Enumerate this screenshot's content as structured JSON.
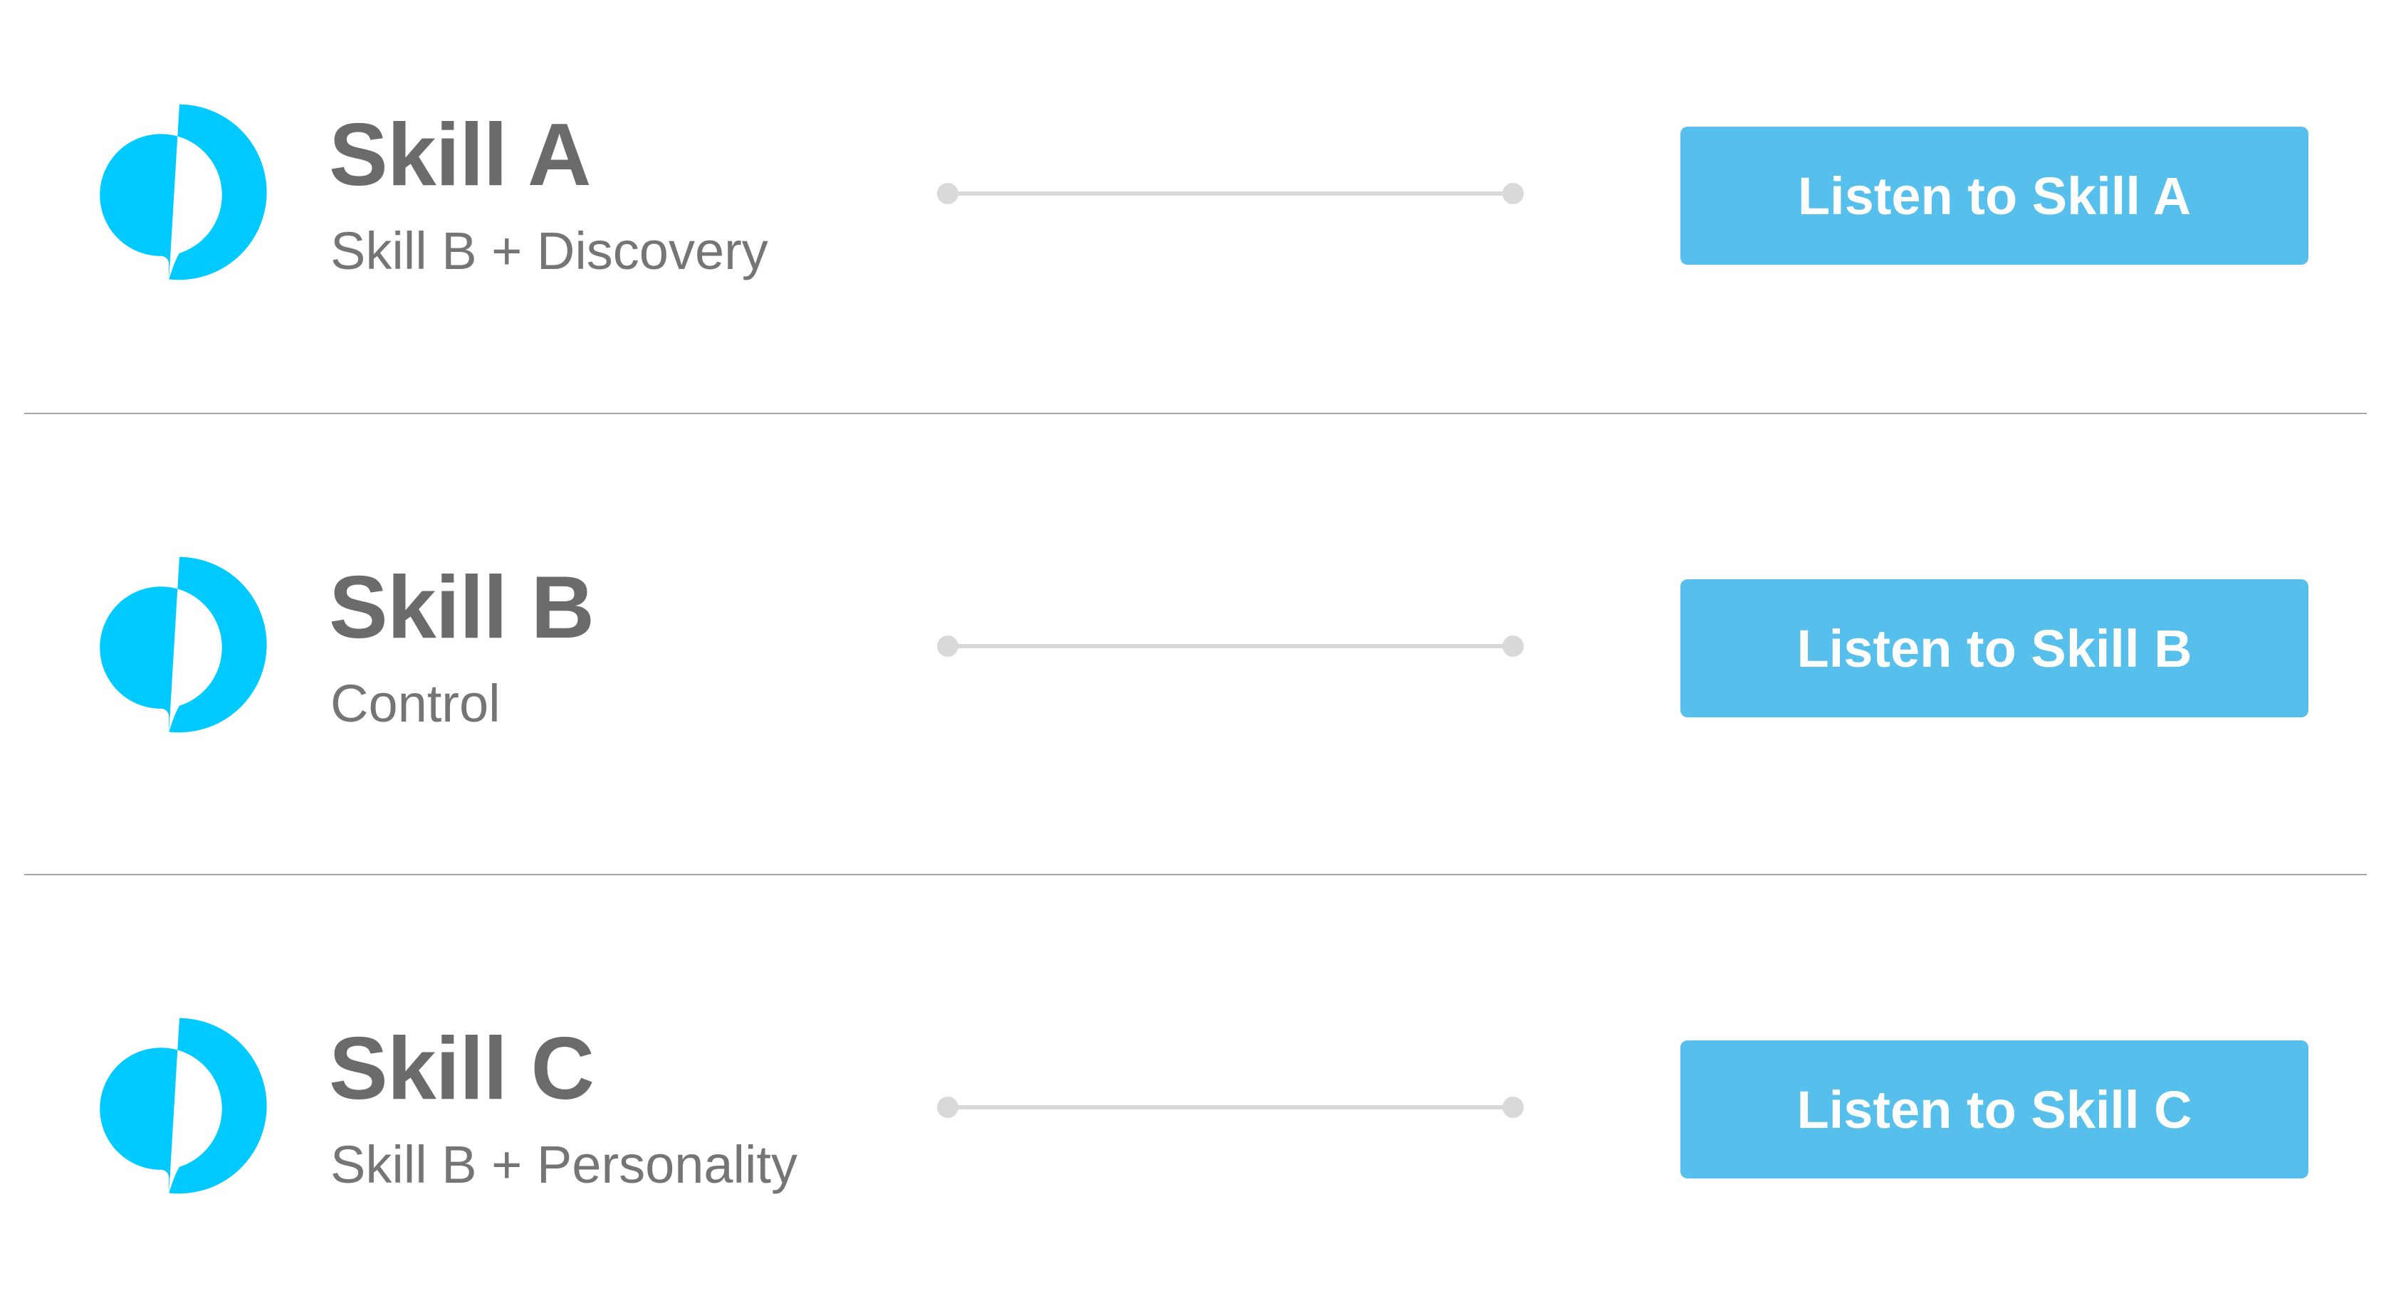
{
  "colors": {
    "accent": "#00caff",
    "button": "#57bfeb",
    "button_text": "#ffffff",
    "title_text": "#6b6b6b",
    "subtitle_text": "#757575",
    "track": "#d9d9d9",
    "divider": "#a6a6a6"
  },
  "skills": [
    {
      "icon": "alexa-ring-icon",
      "title": "Skill A",
      "subtitle": "Skill B + Discovery",
      "button_label": "Listen to Skill A"
    },
    {
      "icon": "alexa-ring-icon",
      "title": "Skill B",
      "subtitle": "Control",
      "button_label": "Listen to Skill B"
    },
    {
      "icon": "alexa-ring-icon",
      "title": "Skill C",
      "subtitle": "Skill B + Personality",
      "button_label": "Listen to Skill C"
    }
  ]
}
